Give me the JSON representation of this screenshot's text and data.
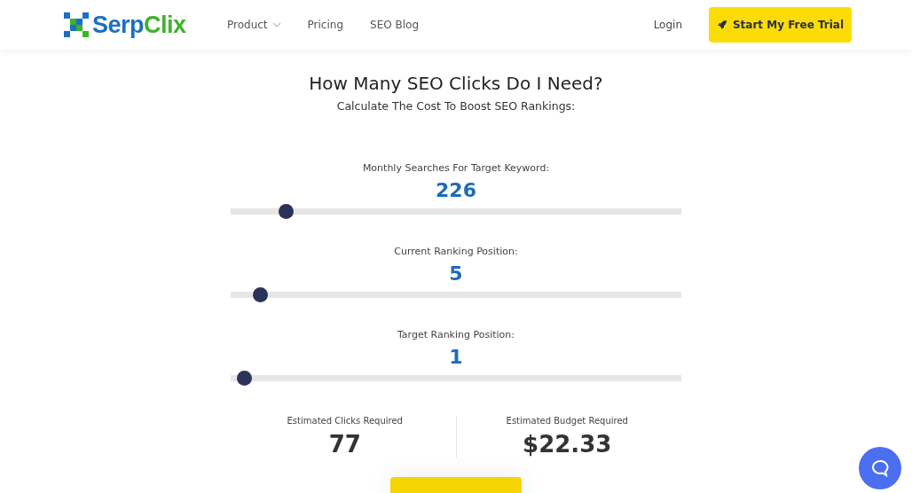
{
  "header": {
    "logo": [
      {
        "text": "Serp",
        "color": "#1c6fc2"
      },
      {
        "text": "Clix",
        "color": "#3db32a"
      }
    ],
    "nav": [
      {
        "label": "Product",
        "dropdown": true
      },
      {
        "label": "Pricing",
        "dropdown": false
      },
      {
        "label": "SEO Blog",
        "dropdown": false
      }
    ],
    "login": "Login",
    "trial_button": "Start My Free Trial"
  },
  "calculator": {
    "title": "How Many SEO Clicks Do I Need?",
    "subtitle": "Calculate The Cost To Boost SEO Rankings:",
    "sliders": [
      {
        "label": "Monthly Searches For Target Keyword:",
        "value": "226",
        "level": 0.11
      },
      {
        "label": "Current Ranking Position:",
        "value": "5",
        "level": 0.05
      },
      {
        "label": "Target Ranking Position:",
        "value": "1",
        "level": 0.014
      }
    ],
    "results": [
      {
        "label": "Estimated Clicks Required",
        "value": "77"
      },
      {
        "label": "Estimated Budget Required",
        "value": "$22.33"
      }
    ]
  }
}
